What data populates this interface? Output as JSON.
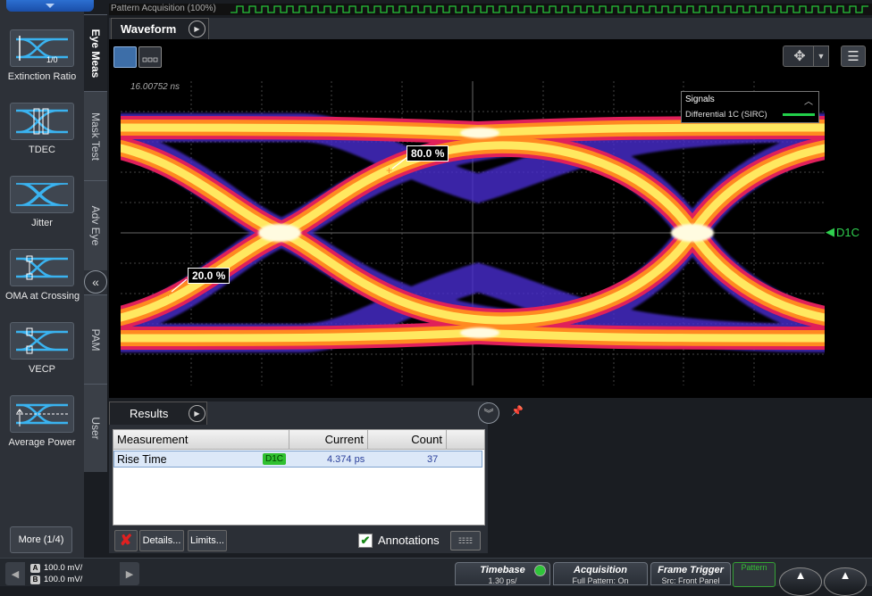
{
  "left_toolbar": {
    "measurements": [
      {
        "label": "Extinction Ratio",
        "icon": "extinction-ratio-icon",
        "icon_text": "1/0"
      },
      {
        "label": "TDEC",
        "icon": "tdec-icon"
      },
      {
        "label": "Jitter",
        "icon": "jitter-icon"
      },
      {
        "label": "OMA at Crossing",
        "icon": "oma-icon"
      },
      {
        "label": "VECP",
        "icon": "vecp-icon"
      },
      {
        "label": "Average Power",
        "icon": "average-power-icon"
      }
    ],
    "more_label": "More (1/4)"
  },
  "vertical_tabs": [
    "Eye Meas",
    "Mask Test",
    "Adv Eye",
    "PAM",
    "User"
  ],
  "pattern_strip": {
    "label": "Pattern Acquisition",
    "progress_text": "(100%)"
  },
  "waveform": {
    "tab_label": "Waveform",
    "time_label": "16.00752 ns",
    "signals": {
      "title": "Signals",
      "entry": "Differential 1C (SIRC)",
      "color": "#22d04a"
    },
    "channel_marker": "D1C",
    "annotations": [
      {
        "label": "80.0 %"
      },
      {
        "label": "20.0 %"
      }
    ]
  },
  "results": {
    "tab_label": "Results",
    "columns": [
      "Measurement",
      "Current",
      "Count"
    ],
    "rows": [
      {
        "measurement": "Rise Time",
        "source": "D1C",
        "current": "4.374 ps",
        "count": "37"
      }
    ],
    "details_label": "Details...",
    "limits_label": "Limits...",
    "annotations_label": "Annotations",
    "annotations_checked": true
  },
  "bottom_bar": {
    "channels": [
      {
        "badge": "A",
        "scale": "100.0 mV/"
      },
      {
        "badge": "B",
        "scale": "100.0 mV/"
      }
    ],
    "timebase": {
      "title": "Timebase",
      "sub": "1.30 ps/"
    },
    "acquisition": {
      "title": "Acquisition",
      "sub": "Full Pattern: On"
    },
    "frame_trigger": {
      "title": "Frame Trigger",
      "sub": "Src: Front Panel"
    },
    "pattern": {
      "title": "Pattern"
    }
  },
  "colors": {
    "accent_blue": "#2c6fd1",
    "signal_green": "#22d04a",
    "eye_core": "#ffe860",
    "eye_edge": "#e0205a",
    "annotation_cross": "#ff8a2a"
  }
}
